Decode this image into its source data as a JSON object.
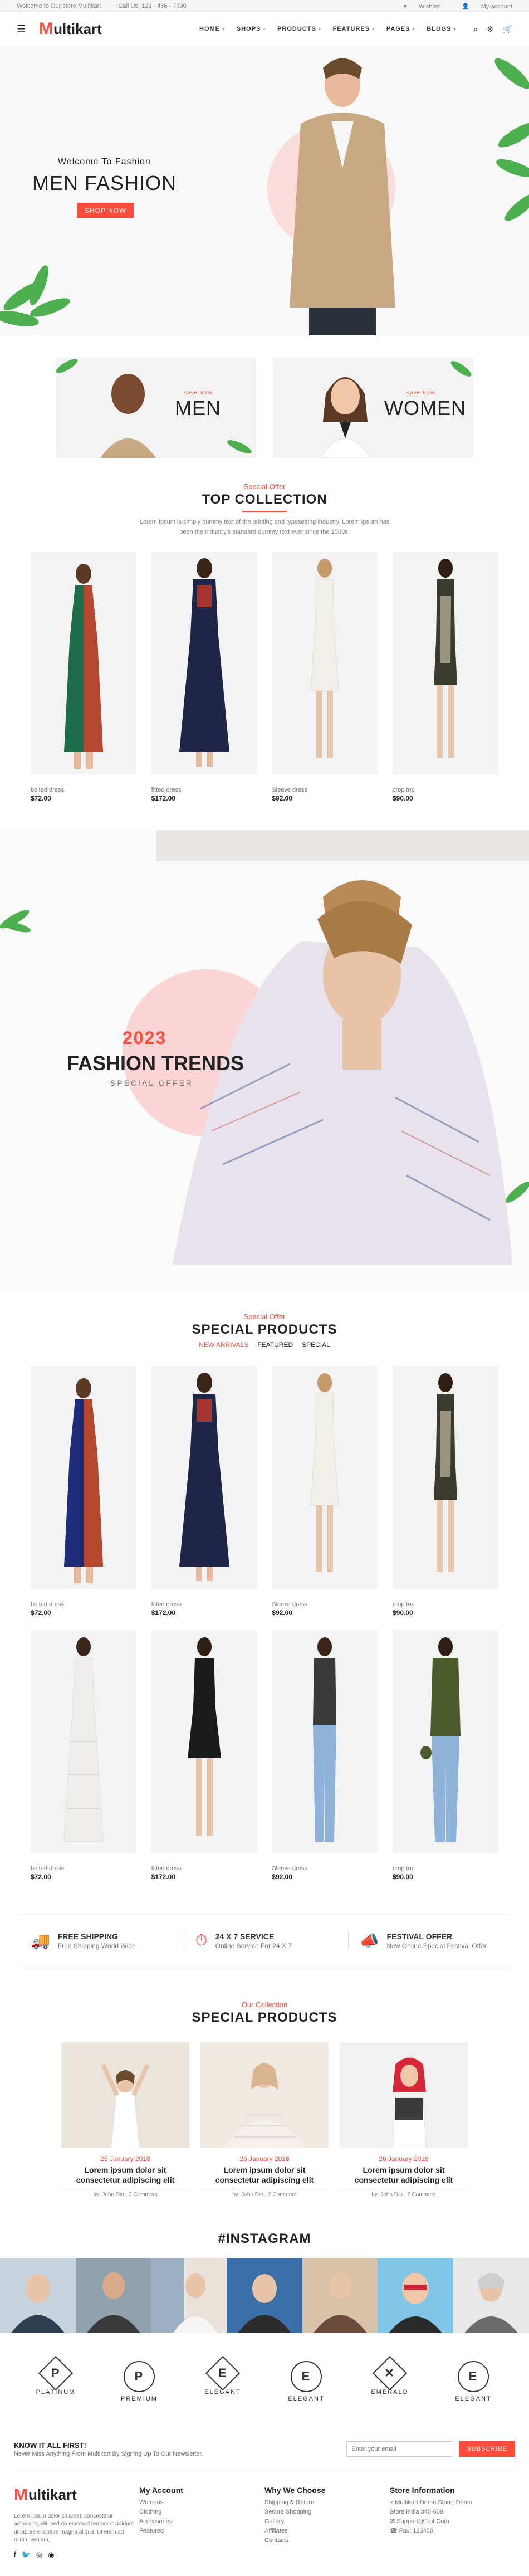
{
  "topbar": {
    "welcome": "Welcome to Our store Multikart",
    "call": "Call Us: 123 - 456 - 7890",
    "wishlist": "Wishlist",
    "account": "My account"
  },
  "header": {
    "logo_m": "M",
    "logo_text": "ultikart",
    "nav": [
      "HOME",
      "SHOPS",
      "PRODUCTS",
      "FEATURES",
      "PAGES",
      "BLOGS"
    ]
  },
  "hero": {
    "subtitle": "Welcome To Fashion",
    "title": "MEN FASHION",
    "button": "SHOP NOW"
  },
  "categories": [
    {
      "save": "save 30%",
      "label": "MEN"
    },
    {
      "save": "save 60%",
      "label": "WOMEN"
    }
  ],
  "top_collection": {
    "kicker": "Special Offer",
    "title": "TOP COLLECTION",
    "description": "Lorem Ipsum is simply dummy text of the printing and typesetting industry. Lorem Ipsum has been the industry's standard dummy text ever since the 1500s."
  },
  "products_top": [
    {
      "name": "belted dress",
      "price": "$72.00"
    },
    {
      "name": "fitted dress",
      "price": "$172.00"
    },
    {
      "name": "Sleeve dress",
      "price": "$92.00"
    },
    {
      "name": "crop top",
      "price": "$90.00"
    }
  ],
  "trends": {
    "year": "2023",
    "title": "FASHION TRENDS",
    "subtitle": "SPECIAL OFFER"
  },
  "special": {
    "kicker": "Special Offer",
    "title": "SPECIAL PRODUCTS",
    "tabs": [
      "NEW ARRIVALS",
      "FEATURED",
      "SPECIAL"
    ]
  },
  "products_special_row1": [
    {
      "name": "belted dress",
      "price": "$72.00"
    },
    {
      "name": "fitted dress",
      "price": "$172.00"
    },
    {
      "name": "Sleeve dress",
      "price": "$92.00"
    },
    {
      "name": "crop top",
      "price": "$90.00"
    }
  ],
  "products_special_row2": [
    {
      "name": "belted dress",
      "price": "$72.00"
    },
    {
      "name": "fitted dress",
      "price": "$172.00"
    },
    {
      "name": "Sleeve dress",
      "price": "$92.00"
    },
    {
      "name": "crop top",
      "price": "$90.00"
    }
  ],
  "services": [
    {
      "title": "FREE SHIPPING",
      "desc": "Free Shipping World Wide"
    },
    {
      "title": "24 X 7 SERVICE",
      "desc": "Online Service For 24 X 7"
    },
    {
      "title": "FESTIVAL OFFER",
      "desc": "New Online Special Festival Offer"
    }
  ],
  "blog_section": {
    "kicker": "Our Collection",
    "title": "SPECIAL PRODUCTS"
  },
  "blogs": [
    {
      "date": "25 January 2018",
      "title": "Lorem ipsum dolor sit consectetur adipiscing elit",
      "meta": "by: John Dio , 2 Comment"
    },
    {
      "date": "26 January 2018",
      "title": "Lorem ipsum dolor sit consectetur adipiscing elit",
      "meta": "by: John Dio , 2 Comment"
    },
    {
      "date": "26 January 2018",
      "title": "Lorem ipsum dolor sit consectetur adipiscing elit",
      "meta": "by: John Dio , 2 Comment"
    }
  ],
  "instagram_title": "#INSTAGRAM",
  "brands": [
    "PLATINUM",
    "PREMIUM",
    "ELEGANT",
    "ELEGANT",
    "EMERALD",
    "ELEGANT"
  ],
  "newsletter": {
    "title": "KNOW IT ALL FIRST!",
    "desc": "Never Miss Anything From Multikart By Signing Up To Our Newsletter.",
    "placeholder": "Enter your email",
    "button": "SUBSCRIBE"
  },
  "footer": {
    "about": "Lorem ipsum dolor sit amet, consectetur adipiscing elit, sed do eiusmod tempor incididunt ut labore et dolore magna aliqua. Ut enim ad minim veniam,",
    "my_account_title": "My Account",
    "my_account": [
      "Womens",
      "Clothing",
      "Accessories",
      "Featured"
    ],
    "why_title": "Why We Choose",
    "why": [
      "Shipping & Return",
      "Secure Shopping",
      "Gallary",
      "Affiliates",
      "Contacts"
    ],
    "store_title": "Store Information",
    "store": [
      "Multikart Demo Store, Demo",
      "Store india 345-659",
      "Support@Fiot.Com",
      "Fax: 123456"
    ]
  }
}
